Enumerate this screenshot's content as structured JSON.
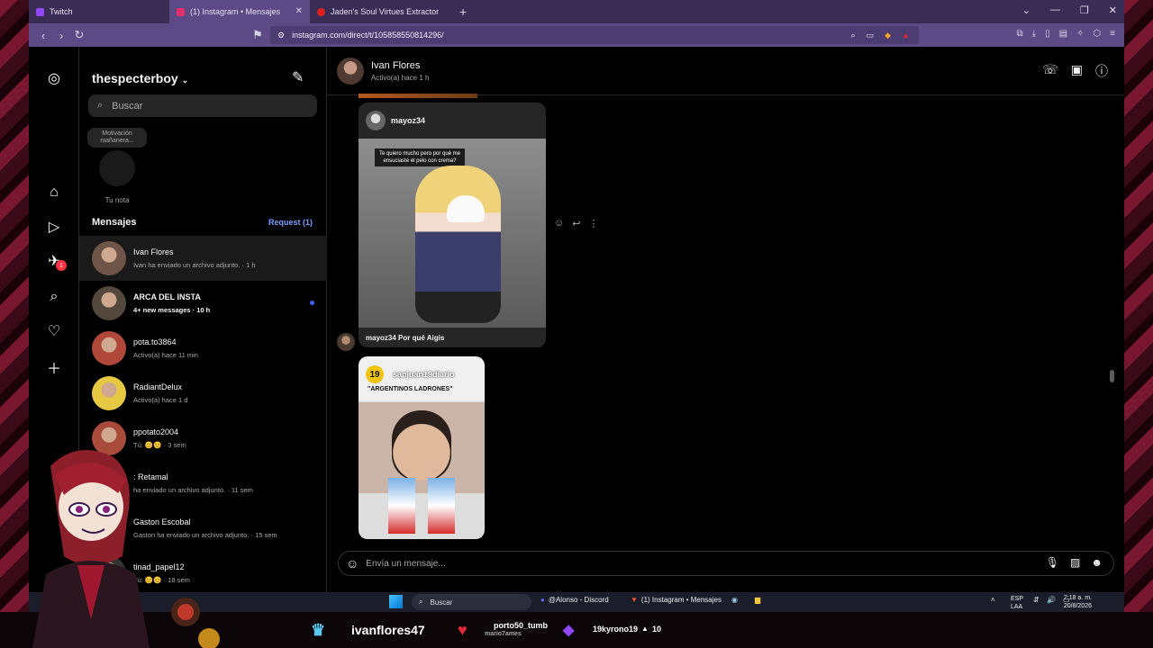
{
  "browser": {
    "tabs": [
      {
        "label": "Twitch",
        "color": "#9146ff"
      },
      {
        "label": "(1) Instagram • Mensajes",
        "color": "#e1306c",
        "active": true
      },
      {
        "label": "Jaden's Soul Virtues Extractor",
        "color": "#e02020"
      }
    ],
    "url": "instagram.com/direct/t/105858550814296/"
  },
  "sidebar": {
    "username": "thespecterboy",
    "search_placeholder": "Buscar",
    "note": {
      "bubble": "Motivación mañanera...",
      "label": "Tu nota"
    },
    "messages_heading": "Mensajes",
    "request_label": "Request (1)",
    "rail_badge": "1",
    "conversations": [
      {
        "name": "Ivan Flores",
        "sub": "Ivan ha enviado un archivo adjunto. · 1 h",
        "selected": true,
        "unread": false,
        "color": "#6e5548"
      },
      {
        "name": "ARCA DEL INSTA",
        "sub": "4+ new messages · 10 h",
        "selected": false,
        "unread": true,
        "color": "#54473c"
      },
      {
        "name": "pota.to3864",
        "sub": "Activo(a) hace 11 min",
        "selected": false,
        "unread": false,
        "color": "#b0483a"
      },
      {
        "name": "RadiantDelux",
        "sub": "Activo(a) hace 1 d",
        "selected": false,
        "unread": false,
        "color": "#e7c843"
      },
      {
        "name": "ppotato2004",
        "sub": "Tú: 😊😊 · 3 sem",
        "selected": false,
        "unread": false,
        "color": "#a84b3a"
      },
      {
        "name": ": Retamal",
        "sub": "ha enviado un archivo adjunto. · 11 sem",
        "selected": false,
        "unread": false,
        "color": "#333333"
      },
      {
        "name": "Gaston Escobal",
        "sub": "Gaston ha enviado un archivo adjunto. · 15 sem",
        "selected": false,
        "unread": false,
        "color": "#333333"
      },
      {
        "name": "tinad_papel12",
        "sub": "Tú: 😊😊 · 18 sem",
        "selected": false,
        "unread": false,
        "color": "#333333"
      }
    ]
  },
  "chat": {
    "contact_name": "Ivan Flores",
    "contact_status": "Activo(a) hace 1 h",
    "share1": {
      "user": "mayoz34",
      "image_caption": "Te quiero mucho pero por qué me ensuciaste el pelo con crema?",
      "caption": "mayoz34 Por qué Aigis"
    },
    "share2": {
      "user": "sanjuan19diario",
      "logo": "19",
      "title": "\"ARGENTINOS LADRONES\""
    },
    "composer_placeholder": "Envía un mensaje..."
  },
  "taskbar": {
    "search_label": "Buscar",
    "discord_label": "@Alonso - Discord",
    "instagram_label": "(1) Instagram • Mensajes",
    "lang_top": "ESP",
    "lang_bottom": "LAA",
    "time": "2:18 a. m.",
    "date": "20/8/2026"
  },
  "stream_overlay": {
    "channel": "ivanflores47",
    "follower": "porto50_tumb",
    "follower_sub": "mario7ames",
    "sub_user": "19kyrono19",
    "sub_count": "10"
  },
  "colors": {
    "accent": "#3f63f5",
    "link": "#7a9dff",
    "notification": "#ff3040",
    "browser": "#5b4a86"
  }
}
